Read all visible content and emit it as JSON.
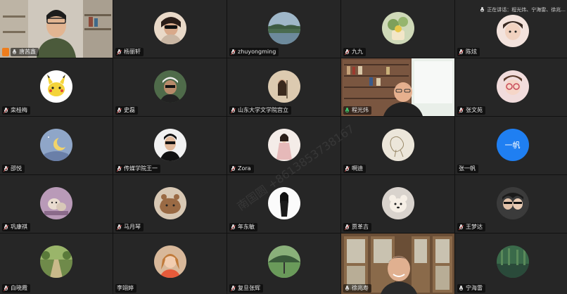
{
  "speaking_indicator": "正在讲话：程光炜、宁海雷、徐兆...",
  "watermark": "南国圆 +8613853738167",
  "participants": [
    {
      "name": "唐茜鑫",
      "kind": "video",
      "mic": "on"
    },
    {
      "name": "杨丽轩",
      "kind": "avatar",
      "mic": "muted",
      "color": "#d9b99a"
    },
    {
      "name": "zhuyongming",
      "kind": "avatar",
      "mic": "muted",
      "color": "#5b7a6e"
    },
    {
      "name": "九九",
      "kind": "avatar",
      "mic": "muted",
      "color": "#b8c89a"
    },
    {
      "name": "陈炫",
      "kind": "avatar",
      "mic": "muted",
      "color": "#e8d2c8"
    },
    {
      "name": "栾桂梅",
      "kind": "avatar",
      "mic": "muted",
      "color": "#f2d54a"
    },
    {
      "name": "史磊",
      "kind": "avatar",
      "mic": "muted",
      "color": "#2e3b2a"
    },
    {
      "name": "山东大学文学院宫立",
      "kind": "avatar",
      "mic": "muted",
      "color": "#d8c6a8"
    },
    {
      "name": "程光炜",
      "kind": "video",
      "mic": "active"
    },
    {
      "name": "张文苑",
      "kind": "avatar",
      "mic": "muted",
      "color": "#e8c9c9"
    },
    {
      "name": "邵悦",
      "kind": "avatar",
      "mic": "muted",
      "color": "#7f93b6"
    },
    {
      "name": "传媒学院王一",
      "kind": "avatar",
      "mic": "muted",
      "color": "#ececec"
    },
    {
      "name": "Zora",
      "kind": "avatar",
      "mic": "muted",
      "color": "#e8dcd6"
    },
    {
      "name": "啊迪",
      "kind": "avatar",
      "mic": "muted",
      "color": "#d9d2c2"
    },
    {
      "name": "张一帆",
      "kind": "text",
      "mic": "none",
      "text": "一帆"
    },
    {
      "name": "巩康祺",
      "kind": "avatar",
      "mic": "muted",
      "color": "#a98fa8"
    },
    {
      "name": "马月琴",
      "kind": "avatar",
      "mic": "muted",
      "color": "#b58a6a"
    },
    {
      "name": "年东敏",
      "kind": "avatar",
      "mic": "muted",
      "color": "#f5f2f0"
    },
    {
      "name": "贾革吉",
      "kind": "avatar",
      "mic": "muted",
      "color": "#c9c2bd"
    },
    {
      "name": "王梦达",
      "kind": "avatar",
      "mic": "muted",
      "color": "#3b3b3b"
    },
    {
      "name": "白晓霞",
      "kind": "avatar",
      "mic": "muted",
      "color": "#7d8f5a"
    },
    {
      "name": "李翊婷",
      "kind": "avatar",
      "mic": "muted",
      "color": "#c98a5a"
    },
    {
      "name": "复旦张辉",
      "kind": "avatar",
      "mic": "muted",
      "color": "#5d8a5a"
    },
    {
      "name": "徐兆寿",
      "kind": "video",
      "mic": "on"
    },
    {
      "name": "宁海雷",
      "kind": "avatar",
      "mic": "on",
      "color": "#2f5a3a"
    }
  ]
}
